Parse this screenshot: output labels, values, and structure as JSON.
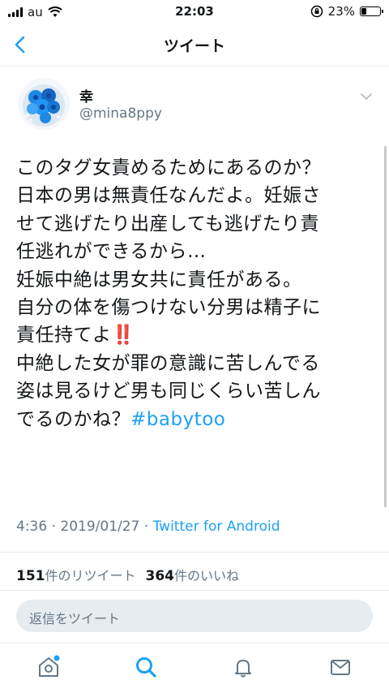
{
  "status_bar": {
    "carrier": "au",
    "time": "22:03",
    "battery_text": "23%",
    "battery_level": 0.23
  },
  "nav": {
    "title": "ツイート",
    "back_icon": "chevron-left-icon"
  },
  "tweet": {
    "display_name": "幸",
    "handle": "@mina8ppy",
    "body_lines": [
      "このタグ女責めるためにあるのか？",
      "日本の男は無責任なんだよ。妊娠さ",
      "せて逃げたり出産しても逃げたり責",
      "任逃れができるから…",
      "妊娠中絶は男女共に責任がある。",
      "自分の体を傷つけない分男は精子に",
      "責任持てよ",
      "中絶した女が罪の意識に苦しんでる",
      "姿は見るけど男も同じくらい苦しん",
      "でるのかね？"
    ],
    "emphasis": "‼️",
    "hashtag": "#babytoo",
    "timestamp": "4:36 · 2019/01/27 · ",
    "source": "Twitter for Android",
    "retweet_count": "151",
    "retweet_label": "件のリツイート",
    "like_count": "364",
    "like_label": "件のいいね"
  },
  "reply": {
    "placeholder": "返信をツイート"
  },
  "tabbar": {
    "items": [
      "home-icon",
      "search-icon",
      "notifications-icon",
      "messages-icon"
    ]
  },
  "colors": {
    "accent": "#1da1f2",
    "secondary_text": "#657786",
    "divider": "#e6ecf0"
  }
}
